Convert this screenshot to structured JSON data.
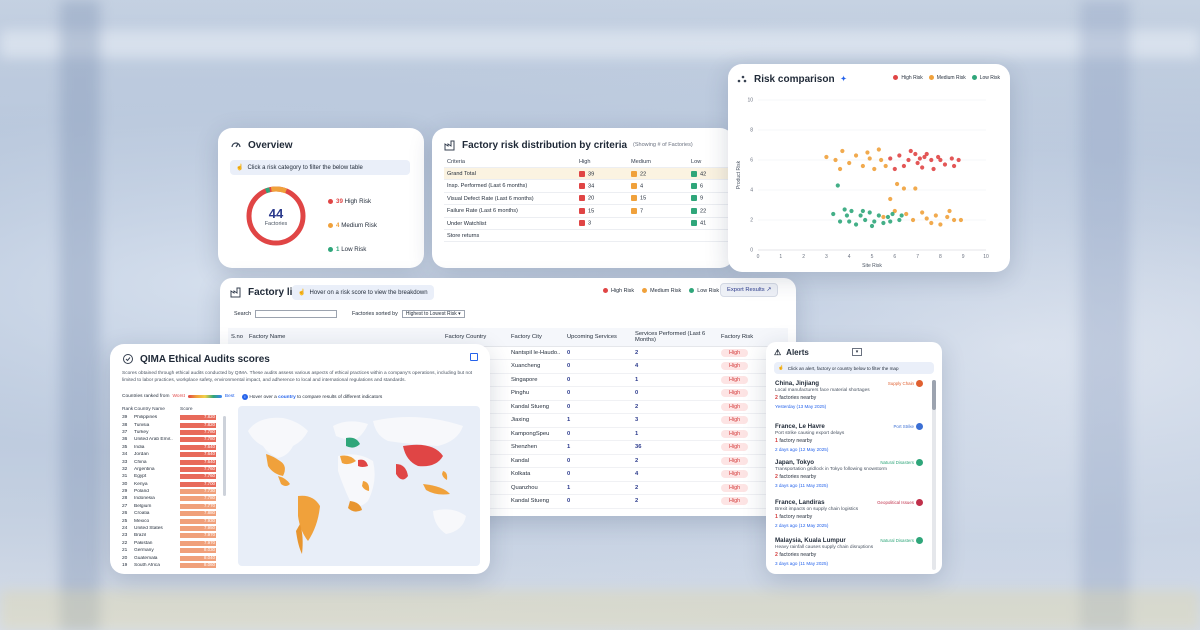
{
  "overview": {
    "title": "Overview",
    "hint": "Click a risk category to filter the below table",
    "total": "44",
    "total_label": "Factories",
    "legend": [
      {
        "count": "39",
        "label": "High Risk",
        "color": "#e04545"
      },
      {
        "count": "4",
        "label": "Medium Risk",
        "color": "#f0a13b"
      },
      {
        "count": "1",
        "label": "Low Risk",
        "color": "#2fa67a"
      }
    ]
  },
  "risk_distribution": {
    "title": "Factory risk distribution by criteria",
    "subtitle": "(Showing # of Factories)",
    "columns": [
      "Criteria",
      "High",
      "Medium",
      "Low"
    ],
    "rows": [
      {
        "criteria": "Grand Total",
        "high": "39",
        "medium": "22",
        "low": "42"
      },
      {
        "criteria": "Insp. Performed (Last 6 months)",
        "high": "34",
        "medium": "4",
        "low": "6"
      },
      {
        "criteria": "Visual Defect Rate (Last 6 months)",
        "high": "20",
        "medium": "15",
        "low": "9"
      },
      {
        "criteria": "Failure Rate (Last 6 months)",
        "high": "15",
        "medium": "7",
        "low": "22"
      },
      {
        "criteria": "Under Watchlist",
        "high": "3",
        "medium": "",
        "low": "41"
      },
      {
        "criteria": "Store returns",
        "high": "",
        "medium": "",
        "low": ""
      }
    ]
  },
  "factory_list": {
    "title": "Factory list",
    "hint": "Hover on a risk score to view the breakdown",
    "legend": [
      "High Risk",
      "Medium Risk",
      "Low Risk"
    ],
    "export_label": "Export Results",
    "search_label": "Search",
    "sort_label": "Factories sorted by",
    "sort_value": "Highest to Lowest Risk",
    "columns": [
      "S.no",
      "Factory Name",
      "Factory Country",
      "Factory City",
      "Upcoming Services",
      "Services Performed (Last 6 Months)",
      "Factory Risk"
    ],
    "rows": [
      {
        "city": "Nantspil le-Haudo..",
        "upcoming": "0",
        "performed": "2",
        "risk": "High"
      },
      {
        "city": "Xuancheng",
        "upcoming": "0",
        "performed": "4",
        "risk": "High"
      },
      {
        "city": "Singapore",
        "upcoming": "0",
        "performed": "1",
        "risk": "High"
      },
      {
        "city": "Pinghu",
        "upcoming": "0",
        "performed": "0",
        "risk": "High"
      },
      {
        "city": "Kandal Stueng",
        "upcoming": "0",
        "performed": "2",
        "risk": "High"
      },
      {
        "city": "Jiaxing",
        "upcoming": "1",
        "performed": "3",
        "risk": "High"
      },
      {
        "city": "KampongSpeu",
        "upcoming": "0",
        "performed": "1",
        "risk": "High"
      },
      {
        "city": "Shenzhen",
        "upcoming": "1",
        "performed": "36",
        "risk": "High"
      },
      {
        "city": "Kandal",
        "upcoming": "0",
        "performed": "2",
        "risk": "High"
      },
      {
        "city": "Kolkata",
        "upcoming": "0",
        "performed": "4",
        "risk": "High"
      },
      {
        "city": "Quanzhou",
        "upcoming": "1",
        "performed": "2",
        "risk": "High"
      },
      {
        "city": "Kandal Stueng",
        "upcoming": "0",
        "performed": "2",
        "risk": "High"
      }
    ]
  },
  "qima": {
    "title": "QIMA Ethical Audits scores",
    "description": "Scores obtained through ethical audits conducted by QIMA. These audits assess various aspects of ethical practices within a company's operations, including but not limited to labor practices, workplace safety, environmental impact, and adherence to local and international regulations and standards.",
    "scale_label": "Countries ranked from",
    "scale_worst": "Worst",
    "scale_best": "Best",
    "map_hint_pre": "Hover over a",
    "map_hint_bold": "country",
    "map_hint_post": "to compare results of different indicators",
    "columns": [
      "Rank",
      "Country Name",
      "Score"
    ],
    "rows": [
      {
        "rank": "39",
        "country": "Philippines",
        "score": "7.820"
      },
      {
        "rank": "38",
        "country": "Tunisia",
        "score": "7.820"
      },
      {
        "rank": "37",
        "country": "Turkey",
        "score": "7.780"
      },
      {
        "rank": "36",
        "country": "United Arab Emir..",
        "score": "7.780"
      },
      {
        "rank": "35",
        "country": "India",
        "score": "7.640"
      },
      {
        "rank": "34",
        "country": "Jordan",
        "score": "7.640"
      },
      {
        "rank": "33",
        "country": "China",
        "score": "7.640"
      },
      {
        "rank": "32",
        "country": "Argentina",
        "score": "7.760"
      },
      {
        "rank": "31",
        "country": "Egypt",
        "score": "7.760"
      },
      {
        "rank": "30",
        "country": "Kenya",
        "score": "7.700"
      },
      {
        "rank": "29",
        "country": "Poland",
        "score": "7.730"
      },
      {
        "rank": "28",
        "country": "Indonesia",
        "score": "7.780"
      },
      {
        "rank": "27",
        "country": "Belgium",
        "score": "7.770"
      },
      {
        "rank": "26",
        "country": "Croatia",
        "score": "7.880"
      },
      {
        "rank": "25",
        "country": "Mexico",
        "score": "7.930"
      },
      {
        "rank": "24",
        "country": "United States",
        "score": "7.950"
      },
      {
        "rank": "23",
        "country": "Brazil",
        "score": "7.970"
      },
      {
        "rank": "22",
        "country": "Pakistan",
        "score": "7.970"
      },
      {
        "rank": "21",
        "country": "Germany",
        "score": "8.030"
      },
      {
        "rank": "20",
        "country": "Guatemala",
        "score": "8.040"
      },
      {
        "rank": "19",
        "country": "South Africa",
        "score": "8.060"
      }
    ]
  },
  "risk_comparison": {
    "title": "Risk comparison",
    "legend": [
      {
        "label": "High Risk",
        "color": "#e04545"
      },
      {
        "label": "Medium Risk",
        "color": "#f0a13b"
      },
      {
        "label": "Low Risk",
        "color": "#2fa67a"
      }
    ]
  },
  "chart_data": {
    "type": "scatter",
    "title": "Risk comparison",
    "xlabel": "Site Risk",
    "ylabel": "Product Risk",
    "xlim": [
      0,
      10
    ],
    "ylim": [
      0,
      10
    ],
    "xticks": [
      "0",
      "1",
      "2",
      "3",
      "4",
      "5",
      "6",
      "7",
      "8",
      "9",
      "10"
    ],
    "yticks": [
      "0",
      "2",
      "4",
      "6",
      "8",
      "10"
    ],
    "series": [
      {
        "name": "High Risk",
        "color": "#e04545",
        "points": [
          [
            5.8,
            6.1
          ],
          [
            6.2,
            6.3
          ],
          [
            6.6,
            6.0
          ],
          [
            7.0,
            5.8
          ],
          [
            7.3,
            6.2
          ],
          [
            7.6,
            6.0
          ],
          [
            7.9,
            6.2
          ],
          [
            8.2,
            5.7
          ],
          [
            8.5,
            6.1
          ],
          [
            6.4,
            5.6
          ],
          [
            6.9,
            6.4
          ],
          [
            7.2,
            5.5
          ],
          [
            7.7,
            5.4
          ],
          [
            8.0,
            6.0
          ],
          [
            8.8,
            6.0
          ],
          [
            6.0,
            5.4
          ],
          [
            7.4,
            6.4
          ],
          [
            8.6,
            5.6
          ],
          [
            6.7,
            6.6
          ],
          [
            7.1,
            6.1
          ]
        ]
      },
      {
        "name": "Medium Risk",
        "color": "#f0a13b",
        "points": [
          [
            3.0,
            6.2
          ],
          [
            3.4,
            6.0
          ],
          [
            3.7,
            6.6
          ],
          [
            4.0,
            5.8
          ],
          [
            4.3,
            6.3
          ],
          [
            4.6,
            5.6
          ],
          [
            4.9,
            6.1
          ],
          [
            5.1,
            5.4
          ],
          [
            5.4,
            6.0
          ],
          [
            5.6,
            5.6
          ],
          [
            3.6,
            5.4
          ],
          [
            4.8,
            6.5
          ],
          [
            5.3,
            6.7
          ],
          [
            6.1,
            4.4
          ],
          [
            6.4,
            4.1
          ],
          [
            6.9,
            4.1
          ],
          [
            5.8,
            3.4
          ],
          [
            6.5,
            2.4
          ],
          [
            6.8,
            2.0
          ],
          [
            7.4,
            2.1
          ],
          [
            7.8,
            2.3
          ],
          [
            8.0,
            1.7
          ],
          [
            8.3,
            2.2
          ],
          [
            8.6,
            2.0
          ],
          [
            8.9,
            2.0
          ],
          [
            7.2,
            2.5
          ],
          [
            6.0,
            2.6
          ],
          [
            5.5,
            2.2
          ],
          [
            7.6,
            1.8
          ],
          [
            8.4,
            2.6
          ]
        ]
      },
      {
        "name": "Low Risk",
        "color": "#2fa67a",
        "points": [
          [
            3.5,
            4.3
          ],
          [
            3.3,
            2.4
          ],
          [
            3.6,
            1.9
          ],
          [
            3.9,
            2.3
          ],
          [
            4.1,
            2.6
          ],
          [
            4.3,
            1.7
          ],
          [
            4.5,
            2.3
          ],
          [
            4.7,
            2.0
          ],
          [
            4.9,
            2.5
          ],
          [
            5.1,
            1.9
          ],
          [
            5.3,
            2.3
          ],
          [
            5.5,
            1.8
          ],
          [
            5.7,
            2.2
          ],
          [
            5.9,
            2.4
          ],
          [
            6.2,
            2.0
          ],
          [
            4.0,
            1.9
          ],
          [
            4.6,
            2.6
          ],
          [
            5.0,
            1.6
          ],
          [
            5.8,
            1.9
          ],
          [
            3.8,
            2.7
          ],
          [
            6.3,
            2.3
          ]
        ]
      }
    ]
  },
  "alerts": {
    "title": "Alerts",
    "hint": "Click an alert, factory or country below to filter the map",
    "items": [
      {
        "title": "China, Jinjiang",
        "tag": "Supply Chain",
        "tag_color": "#e06030",
        "desc": "Local manufacturers face material shortages",
        "count": "2",
        "nearby": "factories nearby",
        "time": "Yesterday (13 May 2025)"
      },
      {
        "title": "France, Le Havre",
        "tag": "Port Strike",
        "tag_color": "#3b6fd4",
        "desc": "Port strike causing export delays",
        "count": "1",
        "nearby": "factory nearby",
        "time": "2 days ago (12 May 2025)"
      },
      {
        "title": "Japan, Tokyo",
        "tag": "Natural Disasters",
        "tag_color": "#2fa67a",
        "desc": "Transportation gridlock in Tokyo following snowstorm",
        "count": "2",
        "nearby": "factories nearby",
        "time": "3 days ago (11 May 2025)"
      },
      {
        "title": "France, Landiras",
        "tag": "Geopolitical Issues",
        "tag_color": "#c0304a",
        "desc": "Brexit impacts on supply chain logistics",
        "count": "1",
        "nearby": "factory nearby",
        "time": "2 days ago (12 May 2025)"
      },
      {
        "title": "Malaysia, Kuala Lumpur",
        "tag": "Natural Disasters",
        "tag_color": "#2fa67a",
        "desc": "Heavy rainfall causes supply chain disruptions",
        "count": "2",
        "nearby": "factories nearby",
        "time": "3 days ago (11 May 2025)"
      }
    ]
  }
}
